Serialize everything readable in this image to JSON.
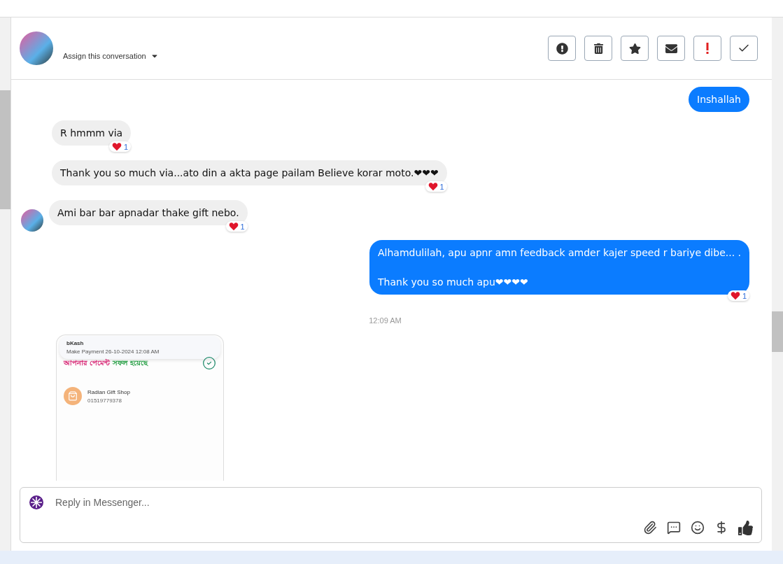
{
  "header": {
    "assign_label": "Assign this conversation",
    "actions": [
      {
        "kind": "alert"
      },
      {
        "kind": "trash"
      },
      {
        "kind": "star"
      },
      {
        "kind": "mail"
      },
      {
        "kind": "urgent"
      },
      {
        "kind": "check"
      }
    ]
  },
  "messages": [
    {
      "kind": "outgoing",
      "text": "Inshallah"
    },
    {
      "kind": "incoming",
      "text": "R hmmm via",
      "reaction": "1",
      "avatar": false
    },
    {
      "kind": "incoming",
      "text": "Thank you so much via...ato din a akta page pailam Believe korar moto.❤❤❤",
      "reaction": "1",
      "avatar": false
    },
    {
      "kind": "incoming",
      "text": "Ami bar bar apnadar thake gift nebo.",
      "reaction": "1",
      "avatar": true
    },
    {
      "kind": "outgoing",
      "lines": [
        "Alhamdulilah, apu apnr amn feedback amder kajer speed r bariye dibe... .",
        "Thank you so much apu❤❤❤❤"
      ],
      "reaction": "1"
    },
    {
      "kind": "time",
      "text": "12:09 AM"
    },
    {
      "kind": "receipt",
      "app": "bKash",
      "notice": "Make Payment 26-10-2024 12:08 AM",
      "status_a": "আপনার পেমেন্ট",
      "status_b": "সফল হয়েছে",
      "shop": "Radian Gift Shop",
      "phone": "01519779378"
    }
  ],
  "composer": {
    "placeholder": "Reply in Messenger...",
    "tools": [
      {
        "kind": "attach"
      },
      {
        "kind": "comment"
      },
      {
        "kind": "emoji"
      },
      {
        "kind": "dollar"
      },
      {
        "kind": "like"
      }
    ]
  }
}
